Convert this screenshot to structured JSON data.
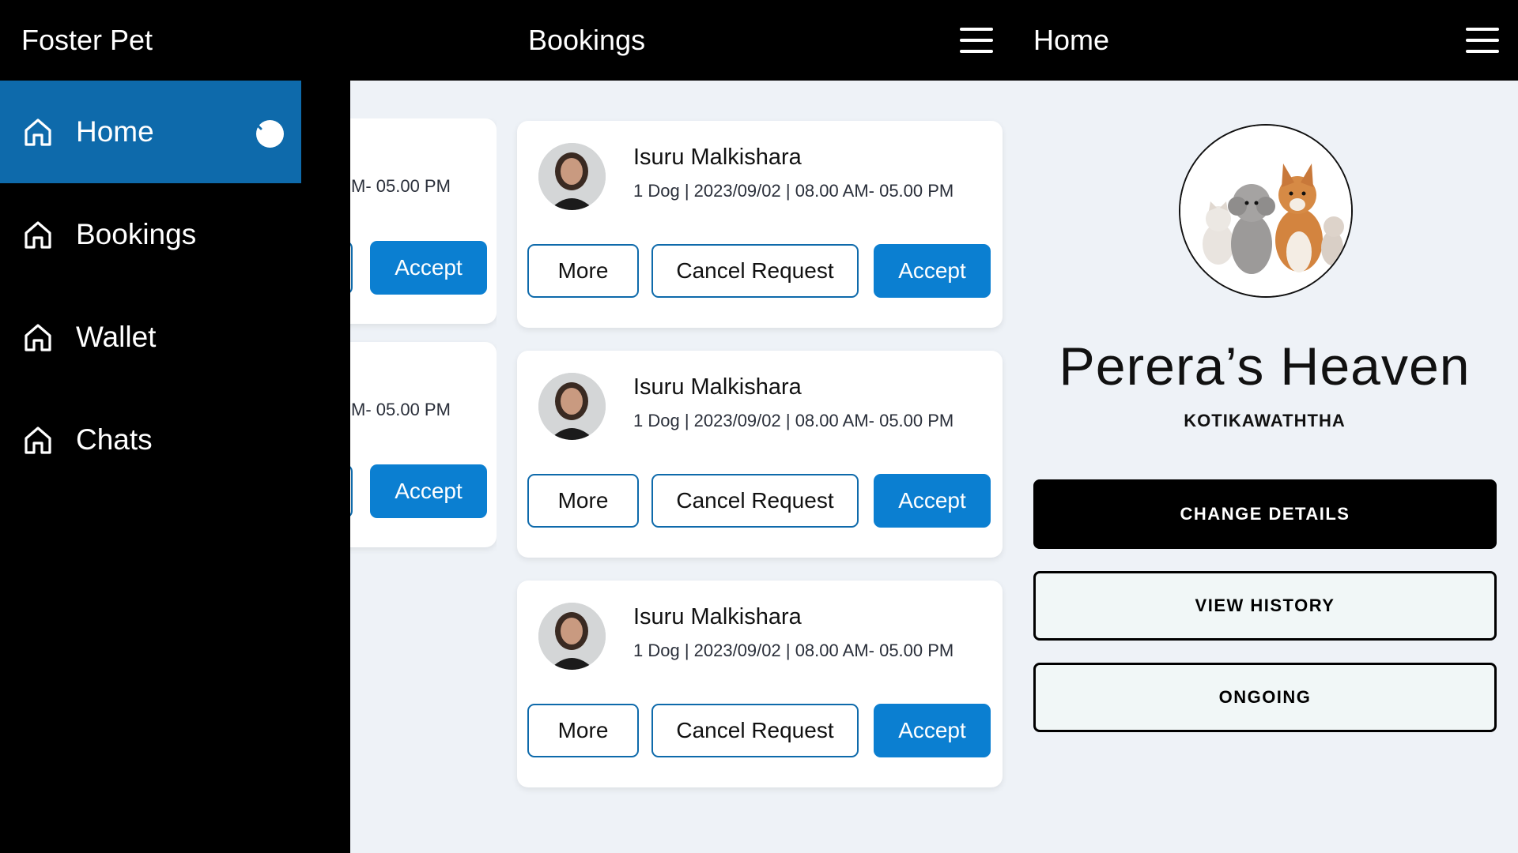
{
  "sidebar": {
    "app_title": "Foster Pet",
    "items": [
      {
        "label": "Home",
        "active": true
      },
      {
        "label": "Bookings",
        "active": false
      },
      {
        "label": "Wallet",
        "active": false
      },
      {
        "label": "Chats",
        "active": false
      }
    ]
  },
  "bookings": {
    "title": "Bookings",
    "partial_cards": [
      {
        "details_visible": "M- 05.00 PM",
        "accept_label": "Accept"
      },
      {
        "details_visible": "M- 05.00 PM",
        "accept_label": "Accept"
      }
    ],
    "cards": [
      {
        "name": "Isuru Malkishara",
        "details": "1 Dog | 2023/09/02 | 08.00 AM- 05.00 PM",
        "more_label": "More",
        "cancel_label": "Cancel Request",
        "accept_label": "Accept"
      },
      {
        "name": "Isuru Malkishara",
        "details": "1 Dog | 2023/09/02 | 08.00 AM- 05.00 PM",
        "more_label": "More",
        "cancel_label": "Cancel Request",
        "accept_label": "Accept"
      },
      {
        "name": "Isuru Malkishara",
        "details": "1 Dog | 2023/09/02 | 08.00 AM- 05.00 PM",
        "more_label": "More",
        "cancel_label": "Cancel Request",
        "accept_label": "Accept"
      }
    ]
  },
  "home": {
    "title": "Home",
    "org_name": "Perera’s Heaven",
    "location": "KOTIKAWATHTHA",
    "buttons": {
      "change_details": "CHANGE DETAILS",
      "view_history": "VIEW HISTORY",
      "ongoing": "ONGOING"
    }
  },
  "colors": {
    "header_bg": "#000000",
    "accent": "#0b7fd1",
    "sidebar_active": "#0e6aab",
    "content_bg": "#eef2f7"
  },
  "icons": {
    "nav": "house-icon",
    "collapse": "chevron-left-icon",
    "menu": "hamburger-menu-icon"
  }
}
